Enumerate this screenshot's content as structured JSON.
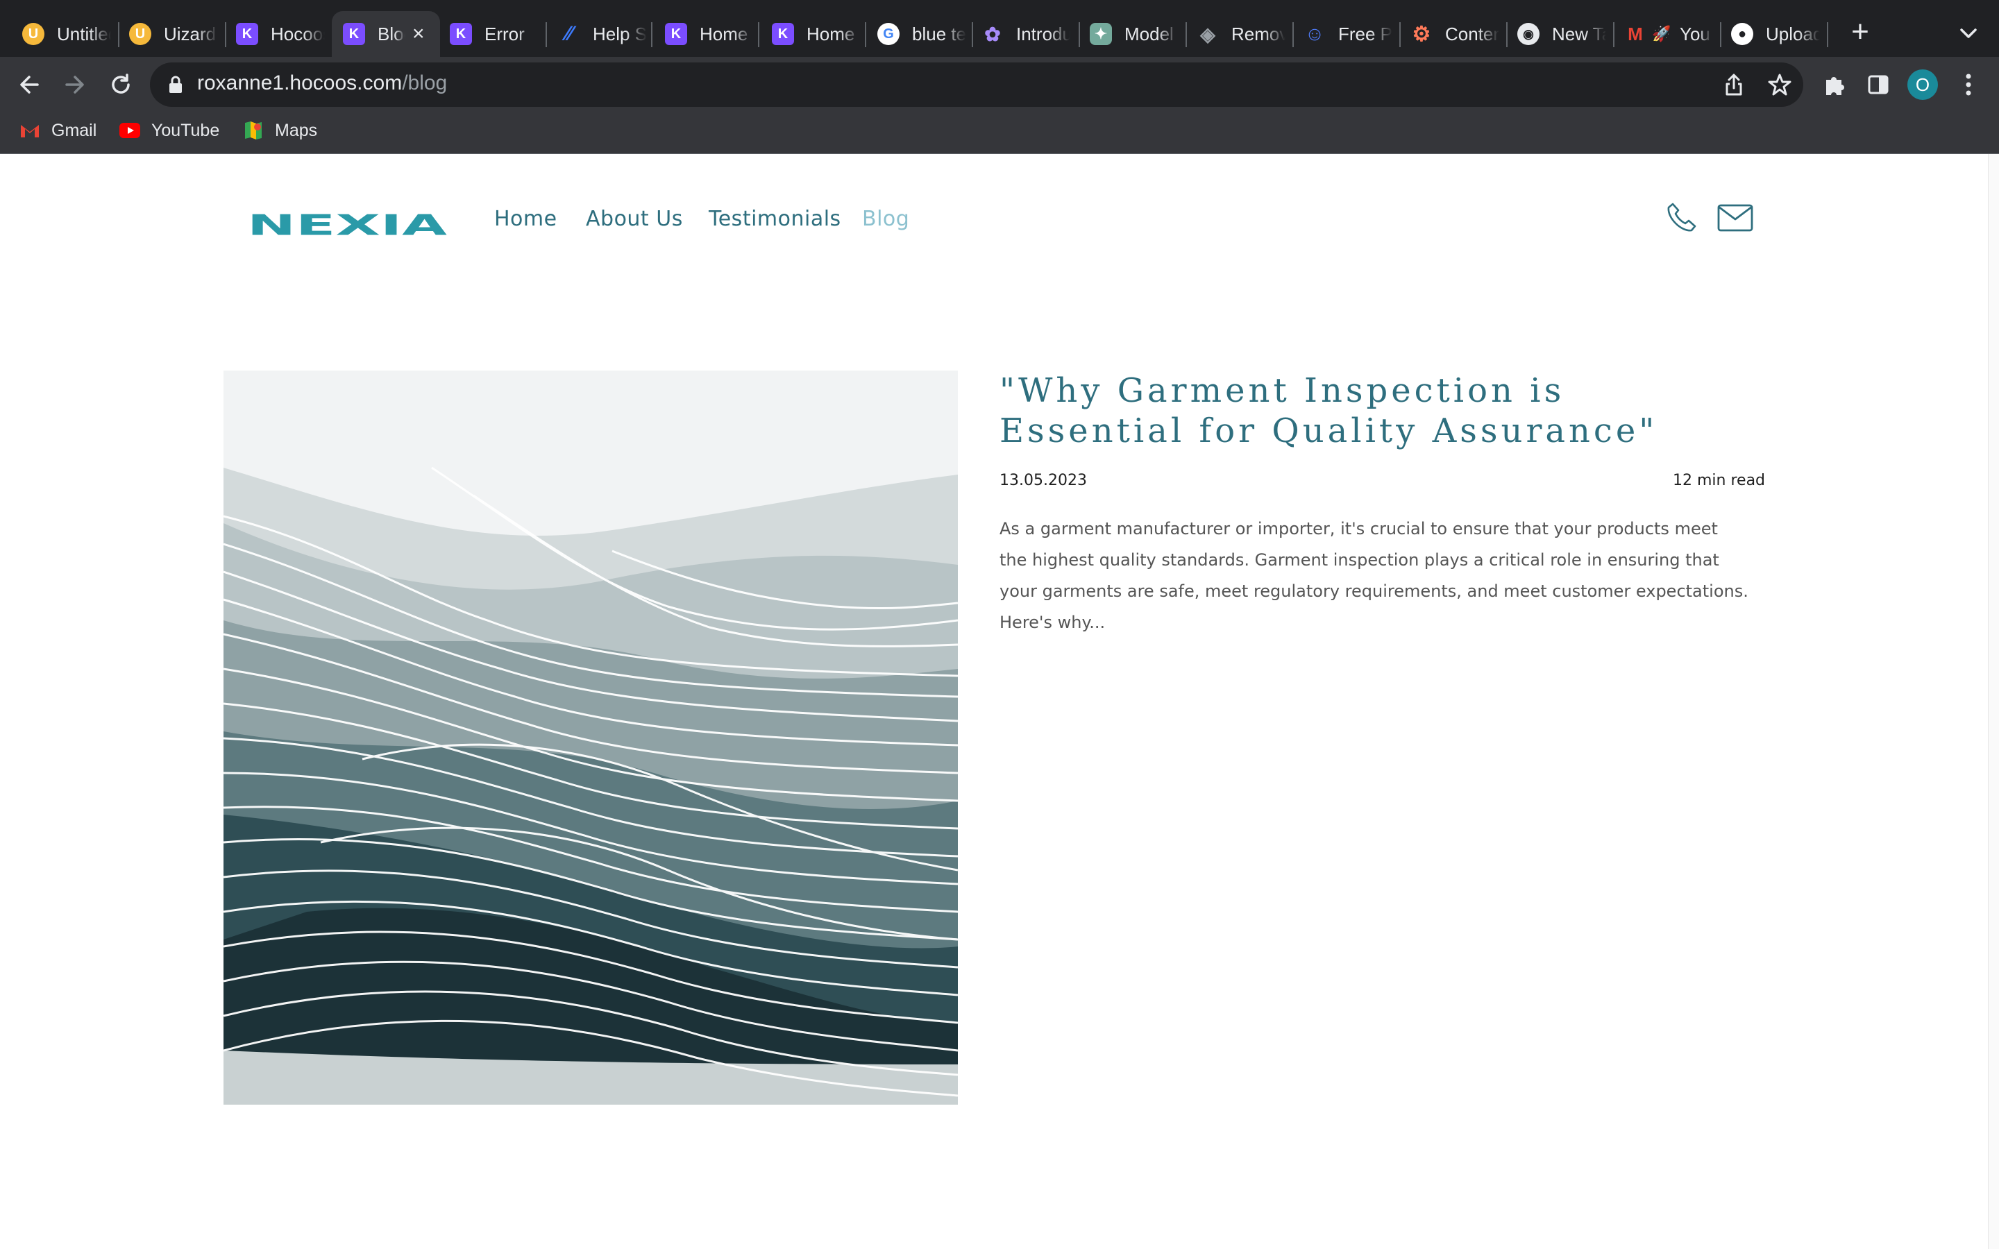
{
  "browser": {
    "tabs": [
      {
        "title": "Untitled",
        "icon": "uizard-icon",
        "color": "#f6b93b"
      },
      {
        "title": "Uizard",
        "icon": "uizard-icon",
        "color": "#f6b93b"
      },
      {
        "title": "Hocoos",
        "icon": "hocoos-icon",
        "color": "#7b4dff"
      },
      {
        "title": "Blog",
        "icon": "hocoos-icon",
        "color": "#7b4dff",
        "active": true
      },
      {
        "title": "Error",
        "icon": "hocoos-icon",
        "color": "#7b4dff"
      },
      {
        "title": "Help S",
        "icon": "linear-icon",
        "color": "#3d7bfd"
      },
      {
        "title": "Home",
        "icon": "hocoos-icon",
        "color": "#7b4dff"
      },
      {
        "title": "Home",
        "icon": "hocoos-icon",
        "color": "#7b4dff"
      },
      {
        "title": "blue te",
        "icon": "google-icon",
        "color": "#ffffff"
      },
      {
        "title": "Introdu",
        "icon": "openai-icon",
        "color": "#a78bfa"
      },
      {
        "title": "Model",
        "icon": "chatgpt-icon",
        "color": "#74aa9c"
      },
      {
        "title": "Remov",
        "icon": "layers-icon",
        "color": "#9aa0a6"
      },
      {
        "title": "Free P",
        "icon": "robot-icon",
        "color": "#4f7bf7"
      },
      {
        "title": "Conten",
        "icon": "hubspot-icon",
        "color": "#ff7a59"
      },
      {
        "title": "New Ta",
        "icon": "chrome-icon",
        "color": "#e8eaed"
      },
      {
        "title": "You",
        "icon": "gmail-icon",
        "color": "#ea4335"
      },
      {
        "title": "Upload",
        "icon": "github-icon",
        "color": "#ffffff"
      }
    ],
    "url_host": "roxanne1.hocoos.com",
    "url_path": "/blog",
    "profile_initial": "O",
    "bookmarks": [
      {
        "label": "Gmail",
        "icon": "gmail-icon"
      },
      {
        "label": "YouTube",
        "icon": "youtube-icon"
      },
      {
        "label": "Maps",
        "icon": "maps-icon"
      }
    ]
  },
  "site": {
    "logo_text": "NEXIA",
    "nav": [
      {
        "label": "Home"
      },
      {
        "label": "About Us"
      },
      {
        "label": "Testimonials"
      },
      {
        "label": "Blog",
        "current": true
      }
    ],
    "accent_color": "#2e6e7e",
    "nav_current_color": "#8cc1cf",
    "header_icons": [
      "phone-icon",
      "mail-icon"
    ]
  },
  "post": {
    "title": "\"Why Garment Inspection is Essential for Quality Assurance\"",
    "date": "13.05.2023",
    "read_time": "12 min read",
    "excerpt": "As a garment manufacturer or importer, it's crucial to ensure that your products meet the highest quality standards. Garment inspection plays a critical role in ensuring that your garments are safe, meet regulatory requirements, and meet customer expectations. Here's why..."
  }
}
